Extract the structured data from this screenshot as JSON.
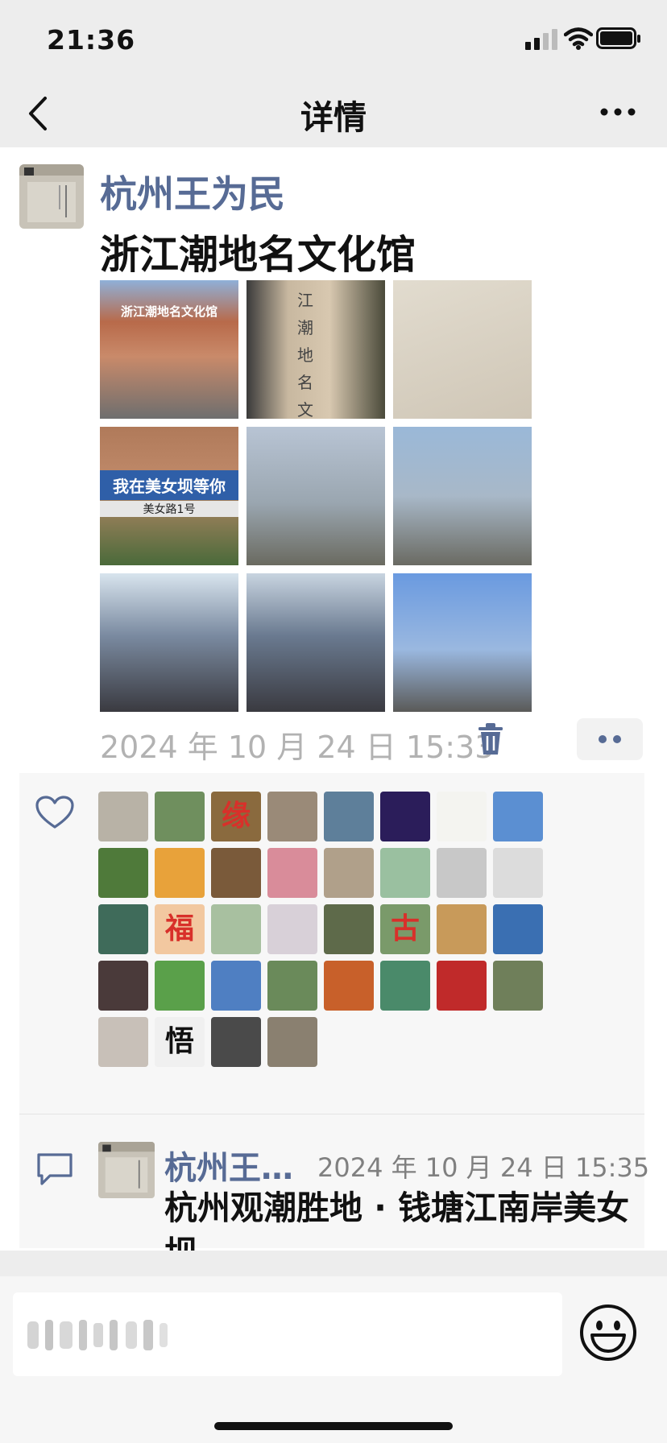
{
  "status_bar": {
    "time": "21:36"
  },
  "nav": {
    "title": "详情"
  },
  "post": {
    "author": "杭州王为民",
    "text": "浙江潮地名文化馆",
    "photos": [
      {
        "caption": "浙江潮地名文化馆",
        "icon": "building-photo"
      },
      {
        "caption": "江潮地名文",
        "icon": "monument-photo"
      },
      {
        "caption": "",
        "icon": "stone-inscription-photo"
      },
      {
        "caption": "我在美女坝等你",
        "caption2": "美女路1号",
        "icon": "street-sign-photo"
      },
      {
        "caption": "",
        "icon": "river-embankment-photo"
      },
      {
        "caption": "",
        "icon": "river-view-photo"
      },
      {
        "caption": "",
        "icon": "group-photo"
      },
      {
        "caption": "",
        "icon": "group-photo"
      },
      {
        "caption": "",
        "icon": "promenade-photo"
      }
    ],
    "time": "2024 年 10 月 24 日 15:33"
  },
  "likes": {
    "icon": "heart-icon",
    "avatars": [
      {
        "bg": "#b8b2a6"
      },
      {
        "bg": "#6f8f5e"
      },
      {
        "bg": "#8a6a3e",
        "text": "缘"
      },
      {
        "bg": "#9a8a78"
      },
      {
        "bg": "#5e7f9a"
      },
      {
        "bg": "#2b1d5a"
      },
      {
        "bg": "#f4f4f0"
      },
      {
        "bg": "#5b8fd2"
      },
      {
        "bg": "#4f7a3a"
      },
      {
        "bg": "#e8a23a"
      },
      {
        "bg": "#7a5a3a"
      },
      {
        "bg": "#d98c9a"
      },
      {
        "bg": "#b0a08a"
      },
      {
        "bg": "#9ac0a0"
      },
      {
        "bg": "#c8c8c8"
      },
      {
        "bg": "#dcdcdc"
      },
      {
        "bg": "#3f6b5a"
      },
      {
        "bg": "#f2c8a0",
        "text": "福"
      },
      {
        "bg": "#a8c0a0"
      },
      {
        "bg": "#d8d0d8"
      },
      {
        "bg": "#5e6a4a"
      },
      {
        "bg": "#7a9a6a",
        "text": "古"
      },
      {
        "bg": "#c89a5a"
      },
      {
        "bg": "#3a6fb2"
      },
      {
        "bg": "#4a3a3a"
      },
      {
        "bg": "#5aa04a"
      },
      {
        "bg": "#4f7fc2"
      },
      {
        "bg": "#6a8a5a"
      },
      {
        "bg": "#c8602a"
      },
      {
        "bg": "#4a8a6a"
      },
      {
        "bg": "#c02a2a"
      },
      {
        "bg": "#6f7f5a"
      },
      {
        "bg": "#c8c0b8"
      },
      {
        "bg": "#f0f0f0",
        "text": "悟"
      },
      {
        "bg": "#4a4a4a"
      },
      {
        "bg": "#8a8070"
      }
    ]
  },
  "comment": {
    "icon": "comment-icon",
    "name": "杭州王…",
    "time": "2024 年 10 月 24 日 15:35",
    "text": "杭州观潮胜地 · 钱塘江南岸美女坝"
  },
  "input": {
    "emoji_icon": "emoji-icon"
  }
}
